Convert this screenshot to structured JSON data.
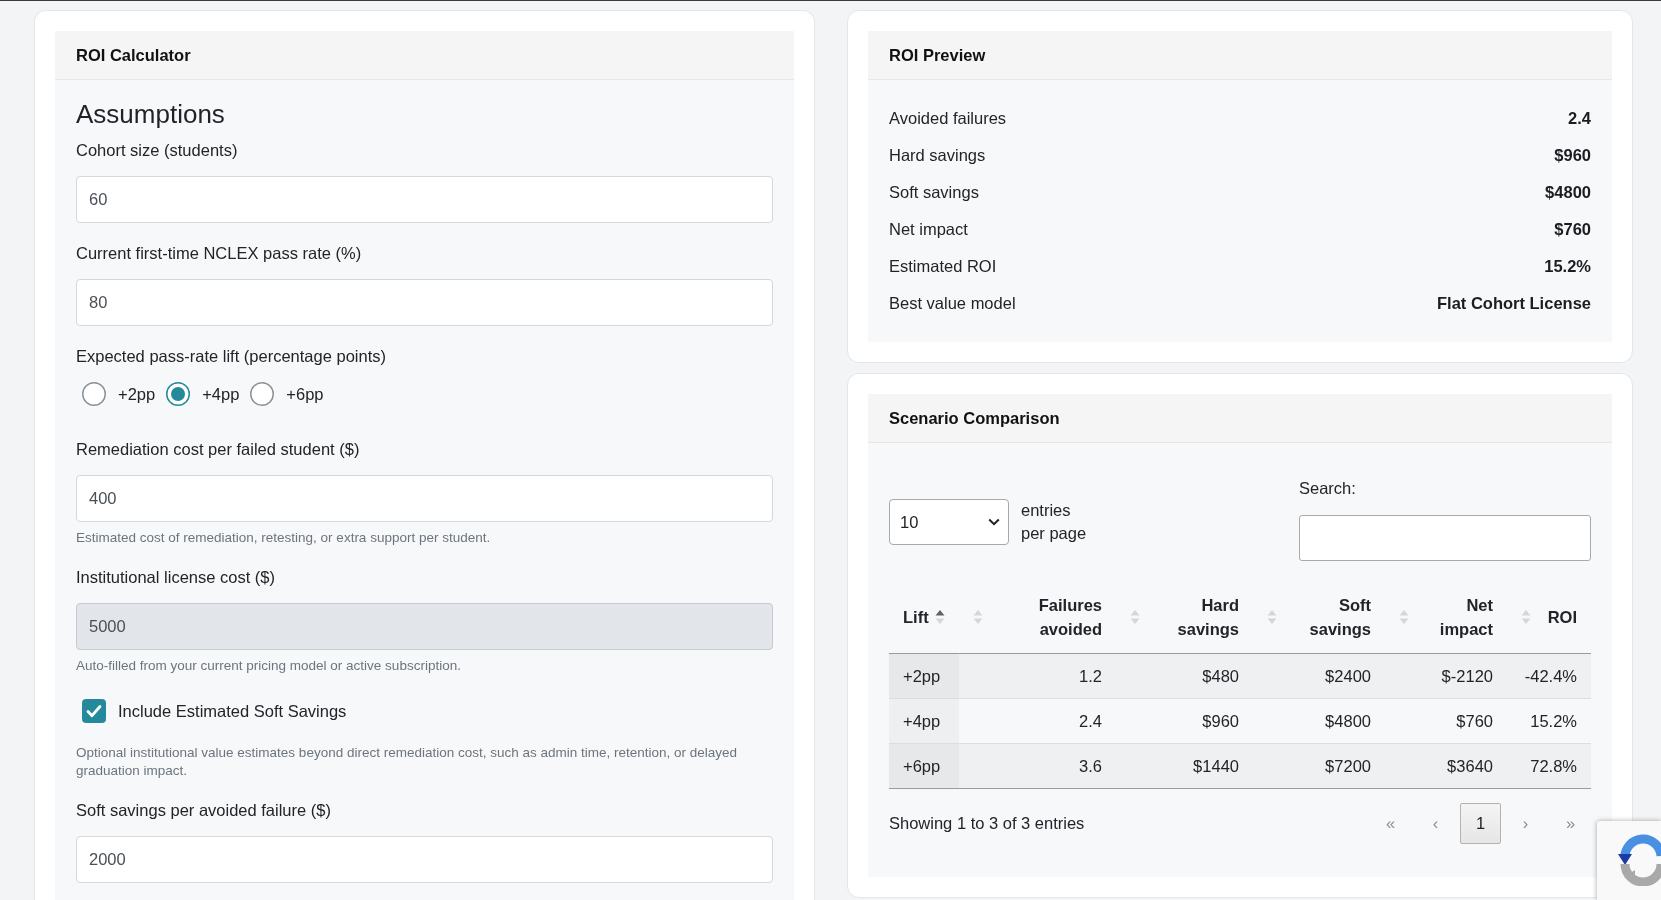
{
  "calculator": {
    "title": "ROI Calculator",
    "heading": "Assumptions",
    "fields": [
      {
        "kind": "input",
        "label": "Cohort size (students)",
        "value": "60",
        "disabled": false
      },
      {
        "kind": "input",
        "label": "Current first-time NCLEX pass rate (%)",
        "value": "80",
        "disabled": false
      },
      {
        "kind": "radio",
        "label": "Expected pass-rate lift (percentage points)",
        "options": [
          {
            "label": "+2pp",
            "selected": false
          },
          {
            "label": "+4pp",
            "selected": true
          },
          {
            "label": "+6pp",
            "selected": false
          }
        ]
      },
      {
        "kind": "input",
        "label": "Remediation cost per failed student ($)",
        "value": "400",
        "disabled": false,
        "help": "Estimated cost of remediation, retesting, or extra support per student."
      },
      {
        "kind": "input",
        "label": "Institutional license cost ($)",
        "value": "5000",
        "disabled": true,
        "help": "Auto-filled from your current pricing model or active subscription."
      },
      {
        "kind": "checkbox",
        "label": "Include Estimated Soft Savings",
        "checked": true,
        "help": "Optional institutional value estimates beyond direct remediation cost, such as admin time, retention, or delayed graduation impact."
      },
      {
        "kind": "input",
        "label": "Soft savings per avoided failure ($)",
        "value": "2000",
        "disabled": false
      }
    ]
  },
  "preview": {
    "title": "ROI Preview",
    "rows": [
      {
        "label": "Avoided failures",
        "value": "2.4"
      },
      {
        "label": "Hard savings",
        "value": "$960"
      },
      {
        "label": "Soft savings",
        "value": "$4800"
      },
      {
        "label": "Net impact",
        "value": "$760"
      },
      {
        "label": "Estimated ROI",
        "value": "15.2%"
      },
      {
        "label": "Best value model",
        "value": "Flat Cohort License"
      }
    ]
  },
  "scenarios": {
    "title": "Scenario Comparison",
    "page_length": {
      "value": "10",
      "label": "entries per page"
    },
    "search": {
      "label": "Search:"
    },
    "columns": [
      {
        "label": "Lift",
        "kind": "text",
        "sorted": true
      },
      {
        "label": "Failures avoided",
        "kind": "numeric",
        "sorted": false
      },
      {
        "label": "Hard savings",
        "kind": "numeric",
        "sorted": false
      },
      {
        "label": "Soft savings",
        "kind": "numeric",
        "sorted": false
      },
      {
        "label": "Net impact",
        "kind": "numeric",
        "sorted": false
      },
      {
        "label": "ROI",
        "kind": "numeric",
        "sorted": false
      }
    ],
    "rows": [
      {
        "cells": [
          "+2pp",
          "1.2",
          "$480",
          "$2400",
          "$-2120",
          "-42.4%"
        ]
      },
      {
        "cells": [
          "+4pp",
          "2.4",
          "$960",
          "$4800",
          "$760",
          "15.2%"
        ]
      },
      {
        "cells": [
          "+6pp",
          "3.6",
          "$1440",
          "$7200",
          "$3640",
          "72.8%"
        ]
      }
    ],
    "info": "Showing 1 to 3 of 3 entries",
    "pagination": [
      {
        "label": "«",
        "disabled": true,
        "selected": false
      },
      {
        "label": "‹",
        "disabled": true,
        "selected": false
      },
      {
        "label": "1",
        "disabled": false,
        "selected": true
      },
      {
        "label": "›",
        "disabled": true,
        "selected": false
      },
      {
        "label": "»",
        "disabled": true,
        "selected": false
      }
    ]
  }
}
